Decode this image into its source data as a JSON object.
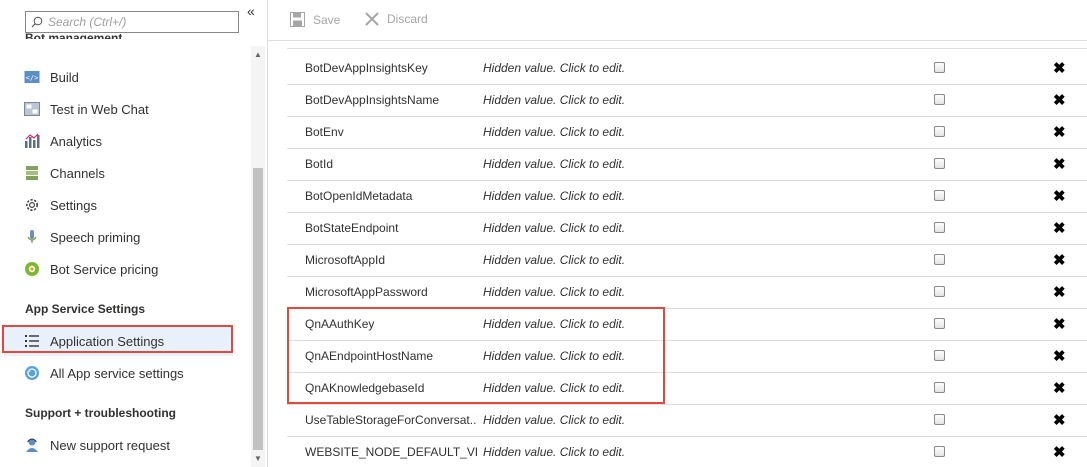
{
  "sidebar": {
    "search_placeholder": "Search (Ctrl+/)",
    "collapse_glyph": "«",
    "cut_section_title": "Bot management",
    "items": [
      {
        "label": "Build",
        "icon": "build-icon"
      },
      {
        "label": "Test in Web Chat",
        "icon": "web-chat-icon"
      },
      {
        "label": "Analytics",
        "icon": "analytics-icon"
      },
      {
        "label": "Channels",
        "icon": "channels-icon"
      },
      {
        "label": "Settings",
        "icon": "gear-icon"
      },
      {
        "label": "Speech priming",
        "icon": "speech-icon"
      },
      {
        "label": "Bot Service pricing",
        "icon": "pricing-icon"
      }
    ],
    "app_service_title": "App Service Settings",
    "app_service_items": [
      {
        "label": "Application Settings",
        "icon": "list-icon",
        "selected": true
      },
      {
        "label": "All App service settings",
        "icon": "app-service-icon"
      }
    ],
    "support_title": "Support + troubleshooting",
    "support_items": [
      {
        "label": "New support request",
        "icon": "support-icon"
      }
    ]
  },
  "toolbar": {
    "save_label": "Save",
    "discard_label": "Discard"
  },
  "settings": {
    "hidden_value_text": "Hidden value. Click to edit.",
    "rows": [
      {
        "name": "BotDevAppInsightsKey"
      },
      {
        "name": "BotDevAppInsightsName"
      },
      {
        "name": "BotEnv"
      },
      {
        "name": "BotId"
      },
      {
        "name": "BotOpenIdMetadata"
      },
      {
        "name": "BotStateEndpoint"
      },
      {
        "name": "MicrosoftAppId"
      },
      {
        "name": "MicrosoftAppPassword"
      },
      {
        "name": "QnAAuthKey"
      },
      {
        "name": "QnAEndpointHostName"
      },
      {
        "name": "QnAKnowledgebaseId"
      },
      {
        "name": "UseTableStorageForConversat..."
      },
      {
        "name": "WEBSITE_NODE_DEFAULT_VE..."
      }
    ]
  },
  "colors": {
    "highlight": "#e0493e",
    "selected_bg": "#e8f1fb",
    "accent": "#0078d4"
  }
}
